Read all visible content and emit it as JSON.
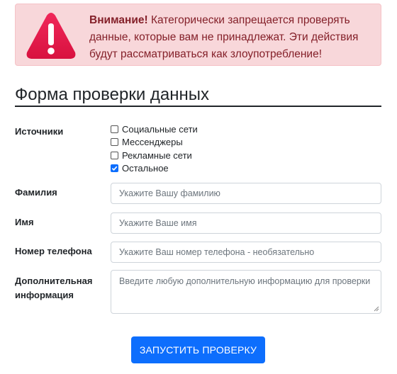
{
  "alert": {
    "strong": "Внимание!",
    "line1": " Категорически запрещается проверять",
    "line2": "данные, которые вам не принадлежат. Эти действия",
    "line3": "будут рассматриваться как злоупотребление!",
    "icon": "warning-triangle-icon",
    "icon_color": "#e5194a"
  },
  "form": {
    "title": "Форма проверки данных",
    "sources": {
      "label": "Источники",
      "options": [
        {
          "label": "Социальные сети",
          "checked": false
        },
        {
          "label": "Мессенджеры",
          "checked": false
        },
        {
          "label": "Рекламные сети",
          "checked": false
        },
        {
          "label": "Остальное",
          "checked": true
        }
      ]
    },
    "surname": {
      "label": "Фамилия",
      "placeholder": "Укажите Вашу фамилию"
    },
    "name": {
      "label": "Имя",
      "placeholder": "Укажите Ваше имя"
    },
    "phone": {
      "label": "Номер телефона",
      "placeholder": "Укажите Ваш номер телефона - необязательно"
    },
    "extra": {
      "label_line1": "Дополнительная",
      "label_line2": "информация",
      "placeholder": "Введите любую дополнительную информацию для проверки"
    },
    "submit_label": "ЗАПУСТИТЬ ПРОВЕРКУ"
  },
  "colors": {
    "primary": "#0d6efd",
    "alert_bg": "#f8d7da",
    "alert_text": "#842029"
  }
}
